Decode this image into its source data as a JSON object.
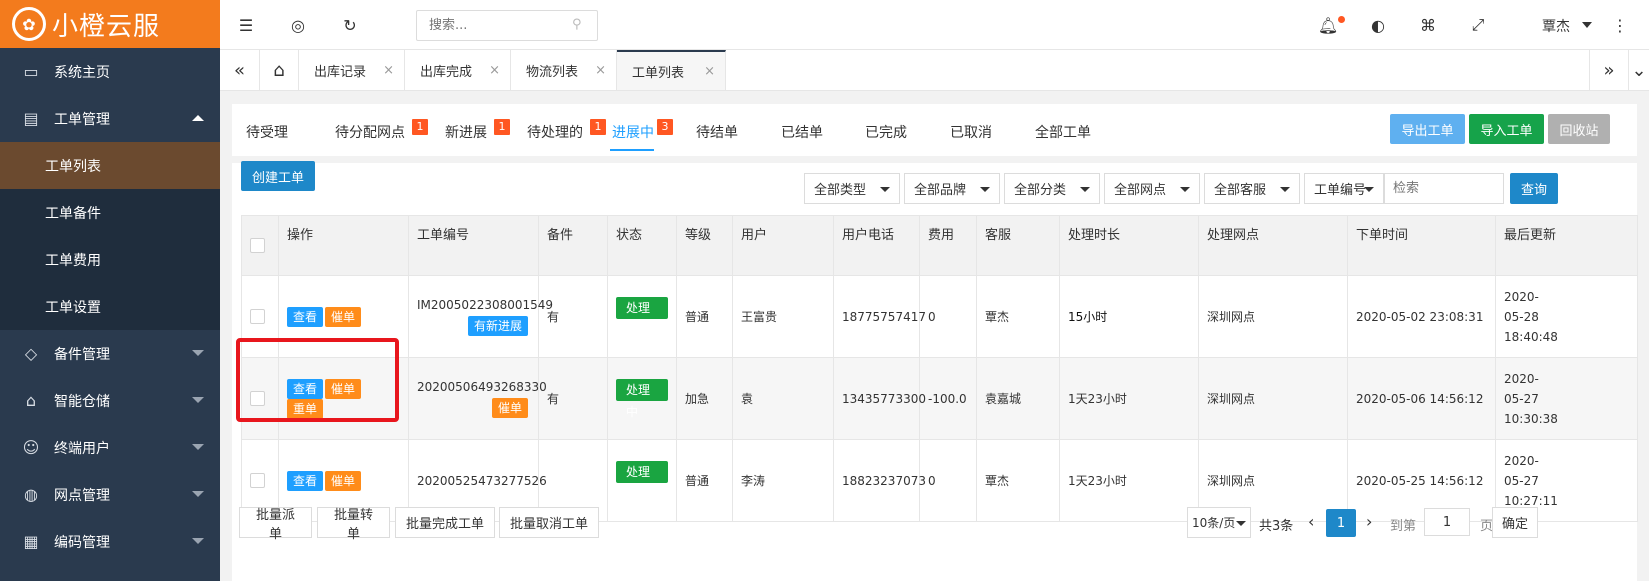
{
  "brand": {
    "name": "小橙云服"
  },
  "sidebar": {
    "items": [
      {
        "label": "系统主页",
        "icon": "monitor-icon"
      },
      {
        "label": "工单管理",
        "icon": "document-icon"
      },
      {
        "label": "备件管理",
        "icon": "code-diamond-icon"
      },
      {
        "label": "智能仓储",
        "icon": "bank-icon"
      },
      {
        "label": "终端用户",
        "icon": "user-icon"
      },
      {
        "label": "网点管理",
        "icon": "globe-icon"
      },
      {
        "label": "编码管理",
        "icon": "grid-icon"
      }
    ],
    "sub_items": [
      {
        "label": "工单列表"
      },
      {
        "label": "工单备件"
      },
      {
        "label": "工单费用"
      },
      {
        "label": "工单设置"
      }
    ]
  },
  "topbar": {
    "search_placeholder": "搜索...",
    "user_name": "覃杰"
  },
  "tabstrip": {
    "tabs": [
      {
        "label": "出库记录"
      },
      {
        "label": "出库完成"
      },
      {
        "label": "物流列表"
      },
      {
        "label": "工单列表"
      }
    ],
    "close": "×"
  },
  "status_tabs": [
    {
      "label": "待受理"
    },
    {
      "label": "待分配网点",
      "badge": "1"
    },
    {
      "label": "新进展",
      "badge": "1"
    },
    {
      "label": "待处理的",
      "badge": "1"
    },
    {
      "label": "进展中",
      "badge": "3"
    },
    {
      "label": "待结单"
    },
    {
      "label": "已结单"
    },
    {
      "label": "已完成"
    },
    {
      "label": "已取消"
    },
    {
      "label": "全部工单"
    }
  ],
  "actions": {
    "export": "导出工单",
    "import": "导入工单",
    "recycle": "回收站",
    "create": "创建工单",
    "query": "查询"
  },
  "filters": {
    "type": "全部类型",
    "brand": "全部品牌",
    "category": "全部分类",
    "site": "全部网点",
    "service": "全部客服",
    "search_field": "工单编号",
    "search_placeholder": "检索"
  },
  "table": {
    "headers": {
      "op": "操作",
      "no": "工单编号",
      "parts": "备件",
      "status": "状态",
      "level": "等级",
      "user": "用户",
      "phone": "用户电话",
      "fee": "费用",
      "service": "客服",
      "duration": "处理时长",
      "site": "处理网点",
      "order_time": "下单时间",
      "updated": "最后更新"
    },
    "btn_view": "查看",
    "btn_urge": "催单",
    "btn_reorder": "重单",
    "rows": [
      {
        "no": "IM2005022308001549",
        "tag": "有新进展",
        "parts": "有",
        "status": "处理中",
        "level": "普通",
        "user": "王富贵",
        "phone": "18775757417",
        "fee": "0",
        "service": "覃杰",
        "duration": "15小时",
        "site": "深圳网点",
        "order_time": "2020-05-02 23:08:31",
        "updated_1": "2020-",
        "updated_2": "05-28",
        "updated_3": "18:40:48"
      },
      {
        "no": "20200506493268330",
        "tag": "催单",
        "parts": "有",
        "status": "处理中",
        "level": "加急",
        "user": "袁",
        "phone": "13435773300",
        "fee": "-100.0",
        "service": "袁嘉城",
        "duration": "1天23小时",
        "site": "深圳网点",
        "order_time": "2020-05-06 14:56:12",
        "updated_1": "2020-",
        "updated_2": "05-27",
        "updated_3": "10:30:38"
      },
      {
        "no": "20200525473277526",
        "parts": "",
        "status": "处理中",
        "level": "普通",
        "user": "李涛",
        "phone": "18823237073",
        "fee": "0",
        "service": "覃杰",
        "duration": "1天23小时",
        "site": "深圳网点",
        "order_time": "2020-05-25 14:56:12",
        "updated_1": "2020-",
        "updated_2": "05-27",
        "updated_3": "10:27:11"
      }
    ]
  },
  "footer": {
    "batch_dispatch": "批量派单",
    "batch_transfer": "批量转单",
    "batch_complete": "批量完成工单",
    "batch_cancel": "批量取消工单",
    "page_size": "10条/页",
    "total": "共3条",
    "page": "1",
    "goto_label": "到第",
    "goto_value": "1",
    "page_unit": "页",
    "confirm": "确定"
  },
  "colors": {
    "brand_orange": "#f37b1d",
    "sidebar_bg": "#2a3a4e",
    "primary_blue": "#1e9fff",
    "success_green": "#16a34a",
    "badge_red": "#ff5722",
    "highlight_red": "#e8161d"
  }
}
